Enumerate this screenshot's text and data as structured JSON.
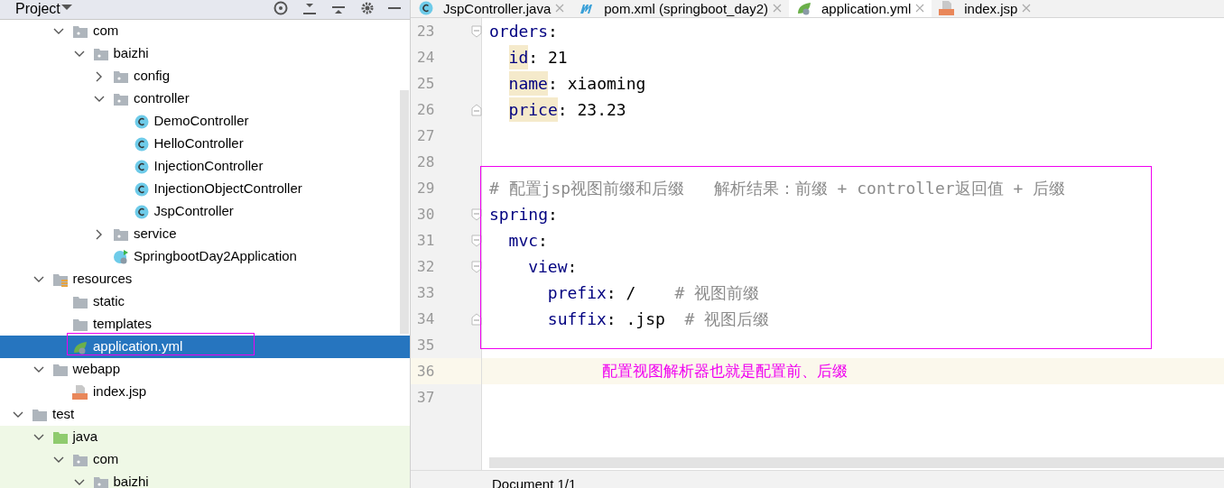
{
  "project_panel": {
    "title": "Project",
    "tree": [
      {
        "children": [
          {
            "children": [
              {
                "label": "com",
                "kind": "package",
                "expanded": true,
                "selected": false,
                "children": [
                  {
                    "label": "baizhi",
                    "kind": "package",
                    "expanded": true,
                    "selected": false,
                    "children": [
                      {
                        "label": "config",
                        "kind": "package",
                        "expanded": false,
                        "selected": false
                      },
                      {
                        "label": "controller",
                        "kind": "package",
                        "expanded": true,
                        "selected": false,
                        "children": [
                          {
                            "label": "DemoController",
                            "kind": "class",
                            "selected": false
                          },
                          {
                            "label": "HelloController",
                            "kind": "class",
                            "selected": false
                          },
                          {
                            "label": "InjectionController",
                            "kind": "class",
                            "selected": false
                          },
                          {
                            "label": "InjectionObjectController",
                            "kind": "class",
                            "selected": false
                          },
                          {
                            "label": "JspController",
                            "kind": "class",
                            "selected": false
                          }
                        ]
                      },
                      {
                        "label": "service",
                        "kind": "package",
                        "expanded": false,
                        "selected": false
                      },
                      {
                        "label": "SpringbootDay2Application",
                        "kind": "app",
                        "selected": false
                      }
                    ]
                  }
                ]
              }
            ]
          },
          {
            "label": "resources",
            "kind": "resources",
            "expanded": true,
            "selected": false,
            "children": [
              {
                "label": "static",
                "kind": "folder",
                "selected": false
              },
              {
                "label": "templates",
                "kind": "folder",
                "selected": false
              },
              {
                "label": "application.yml",
                "kind": "yml",
                "selected": true
              }
            ]
          },
          {
            "label": "webapp",
            "kind": "folder",
            "expanded": true,
            "selected": false,
            "children": [
              {
                "label": "index.jsp",
                "kind": "jsp",
                "selected": false
              }
            ]
          }
        ]
      },
      {
        "label": "test",
        "kind": "folder",
        "expanded": true,
        "selected": false,
        "children": [
          {
            "label": "java",
            "kind": "test-root",
            "expanded": true,
            "selected": false,
            "children": [
              {
                "label": "com",
                "kind": "package",
                "expanded": true,
                "selected": false,
                "children": [
                  {
                    "label": "baizhi",
                    "kind": "package",
                    "expanded": true,
                    "selected": false
                  }
                ]
              }
            ]
          }
        ]
      }
    ]
  },
  "tabs": [
    {
      "label": "JspController.java",
      "kind": "class",
      "selected": false
    },
    {
      "label": "pom.xml (springboot_day2)",
      "kind": "maven",
      "selected": false
    },
    {
      "label": "application.yml",
      "kind": "yml",
      "selected": true
    },
    {
      "label": "index.jsp",
      "kind": "jsp",
      "selected": false
    }
  ],
  "editor": {
    "lines": [
      {
        "number": "23",
        "fold_start": true,
        "current": false,
        "segments": [
          {
            "kind": "key",
            "text": "orders"
          },
          {
            "kind": "punct",
            "text": ":"
          }
        ],
        "children": [
          {
            "number": "24",
            "current": false,
            "segments": [
              {
                "kind": "key",
                "text": "id",
                "highlighted": true
              },
              {
                "kind": "punct",
                "text": ": "
              },
              {
                "kind": "value",
                "text": "21"
              }
            ]
          },
          {
            "number": "25",
            "current": false,
            "segments": [
              {
                "kind": "key",
                "text": "name",
                "highlighted": true
              },
              {
                "kind": "punct",
                "text": ": "
              },
              {
                "kind": "value",
                "text": "xiaoming"
              }
            ]
          },
          {
            "number": "26",
            "fold_end": true,
            "current": false,
            "segments": [
              {
                "kind": "key",
                "text": "price",
                "highlighted": true
              },
              {
                "kind": "punct",
                "text": ": "
              },
              {
                "kind": "value",
                "text": "23.23"
              }
            ]
          }
        ]
      },
      {
        "number": "27",
        "current": false
      },
      {
        "number": "28",
        "current": false
      },
      {
        "number": "29",
        "current": false,
        "segments": [
          {
            "kind": "comment",
            "text": "# 配置jsp视图前缀和后缀   解析结果：前缀 + controller返回值 + 后缀"
          }
        ]
      },
      {
        "number": "30",
        "fold_start": true,
        "current": false,
        "segments": [
          {
            "kind": "key",
            "text": "spring"
          },
          {
            "kind": "punct",
            "text": ":"
          }
        ],
        "children": [
          {
            "number": "31",
            "fold_start": true,
            "current": false,
            "segments": [
              {
                "kind": "key",
                "text": "mvc"
              },
              {
                "kind": "punct",
                "text": ":"
              }
            ],
            "children": [
              {
                "number": "32",
                "fold_start": true,
                "current": false,
                "segments": [
                  {
                    "kind": "key",
                    "text": "view"
                  },
                  {
                    "kind": "punct",
                    "text": ":"
                  }
                ],
                "children": [
                  {
                    "number": "33",
                    "current": false,
                    "segments": [
                      {
                        "kind": "key",
                        "text": "prefix"
                      },
                      {
                        "kind": "punct",
                        "text": ": "
                      },
                      {
                        "kind": "value",
                        "text": "/"
                      },
                      {
                        "kind": "comment",
                        "text": "# 视图前缀"
                      }
                    ]
                  },
                  {
                    "number": "34",
                    "fold_end": true,
                    "current": false,
                    "segments": [
                      {
                        "kind": "key",
                        "text": "suffix"
                      },
                      {
                        "kind": "punct",
                        "text": ": "
                      },
                      {
                        "kind": "value",
                        "text": ".jsp"
                      },
                      {
                        "kind": "comment",
                        "text": "# 视图后缀"
                      }
                    ]
                  }
                ]
              }
            ]
          }
        ]
      },
      {
        "number": "35",
        "current": false
      },
      {
        "number": "36",
        "current": true,
        "segments": [
          {
            "kind": "note",
            "text": "配置视图解析器也就是配置前、后缀"
          }
        ]
      },
      {
        "number": "37",
        "current": false
      }
    ]
  },
  "status_bar": {
    "text": "Document 1/1"
  }
}
